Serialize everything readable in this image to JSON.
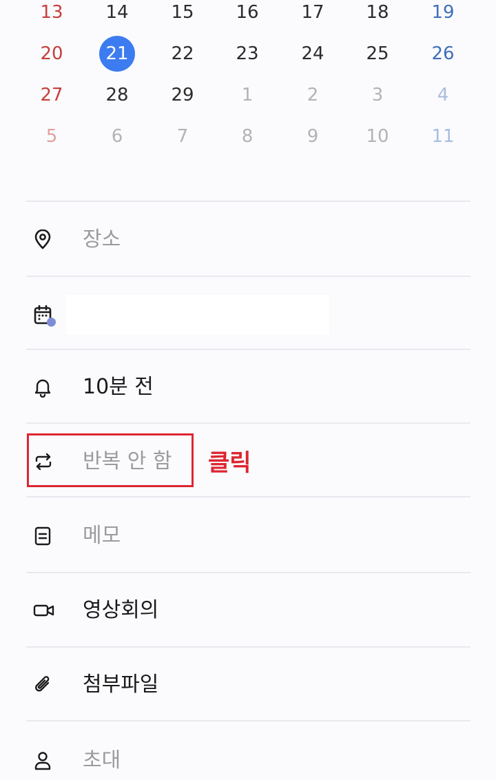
{
  "calendar": {
    "weeks": [
      [
        "13",
        "14",
        "15",
        "16",
        "17",
        "18",
        "19"
      ],
      [
        "20",
        "21",
        "22",
        "23",
        "24",
        "25",
        "26"
      ],
      [
        "27",
        "28",
        "29",
        "1",
        "2",
        "3",
        "4"
      ],
      [
        "5",
        "6",
        "7",
        "8",
        "9",
        "10",
        "11"
      ]
    ],
    "selected_day": "21"
  },
  "fields": {
    "location": {
      "label": "장소",
      "icon": "location-pin-icon"
    },
    "calendar": {
      "label": "",
      "icon": "calendar-icon",
      "dot_color": "#7f8dd6"
    },
    "alarm": {
      "label": "10분 전",
      "icon": "bell-icon"
    },
    "repeat": {
      "label": "반복 안 함",
      "icon": "repeat-icon"
    },
    "memo": {
      "label": "메모",
      "icon": "memo-icon"
    },
    "video": {
      "label": "영상회의",
      "icon": "video-camera-icon"
    },
    "attachment": {
      "label": "첨부파일",
      "icon": "paperclip-icon"
    },
    "invite": {
      "label": "초대",
      "icon": "person-icon"
    }
  },
  "annotation": {
    "click_note": "클릭",
    "color": "#dd2530"
  },
  "colors": {
    "accent": "#3d7cf0",
    "sunday": "#c7403a",
    "saturday": "#3f6fb8"
  }
}
